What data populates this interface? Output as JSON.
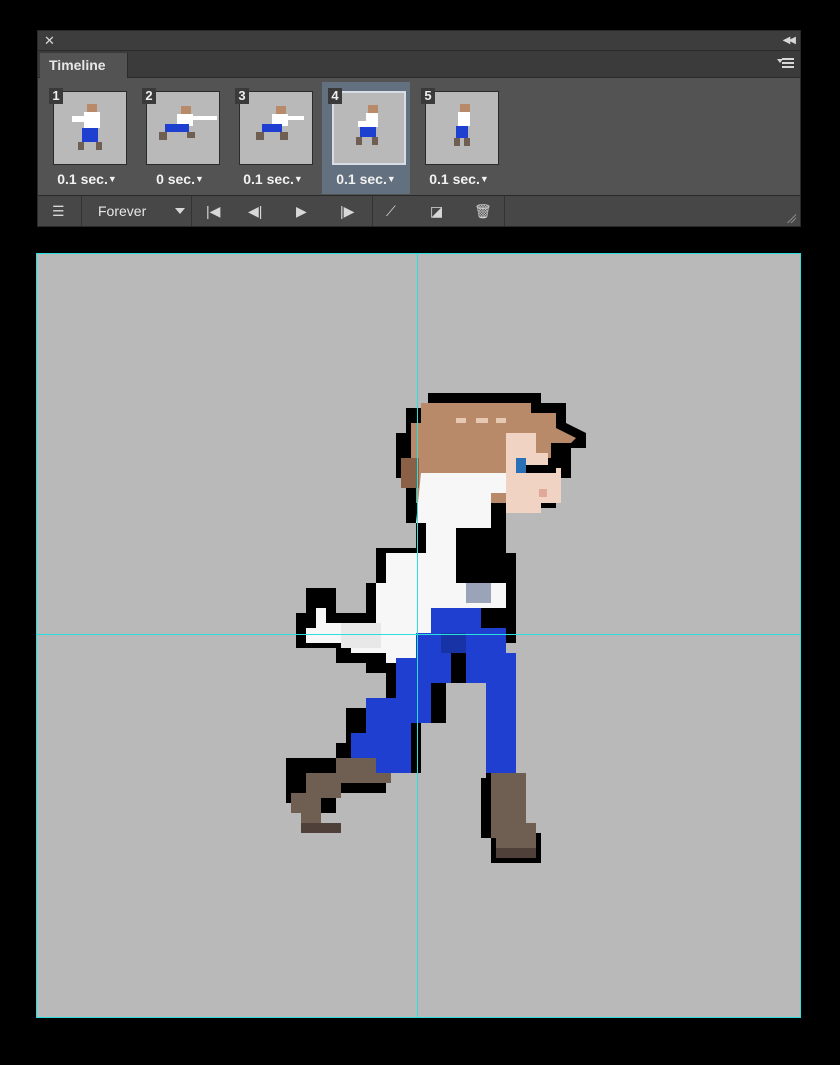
{
  "panel": {
    "close_icon": "close-icon",
    "collapse_icon": "double-chevron-icon",
    "tab_label": "Timeline",
    "menu_icon": "panel-menu-icon"
  },
  "frames": [
    {
      "number": "1",
      "delay": "0.1 sec.",
      "selected": false
    },
    {
      "number": "2",
      "delay": "0 sec.",
      "selected": false
    },
    {
      "number": "3",
      "delay": "0.1 sec.",
      "selected": false
    },
    {
      "number": "4",
      "delay": "0.1 sec.",
      "selected": true
    },
    {
      "number": "5",
      "delay": "0.1 sec.",
      "selected": false
    }
  ],
  "toolbar": {
    "loop_value": "Forever",
    "icons": [
      "convert-timeline-icon",
      "first-frame-icon",
      "previous-frame-icon",
      "play-icon",
      "next-frame-icon",
      "tween-icon",
      "duplicate-frame-icon",
      "trash-icon"
    ]
  },
  "colors": {
    "panel_bg": "#535353",
    "selected_frame": "#62707f",
    "canvas_bg": "#b9b9b9",
    "guide": "#29e0df",
    "hair": "#b98a6a",
    "shirt": "#ffffff",
    "pants": "#1f3fd1",
    "boots": "#6f5f52"
  }
}
